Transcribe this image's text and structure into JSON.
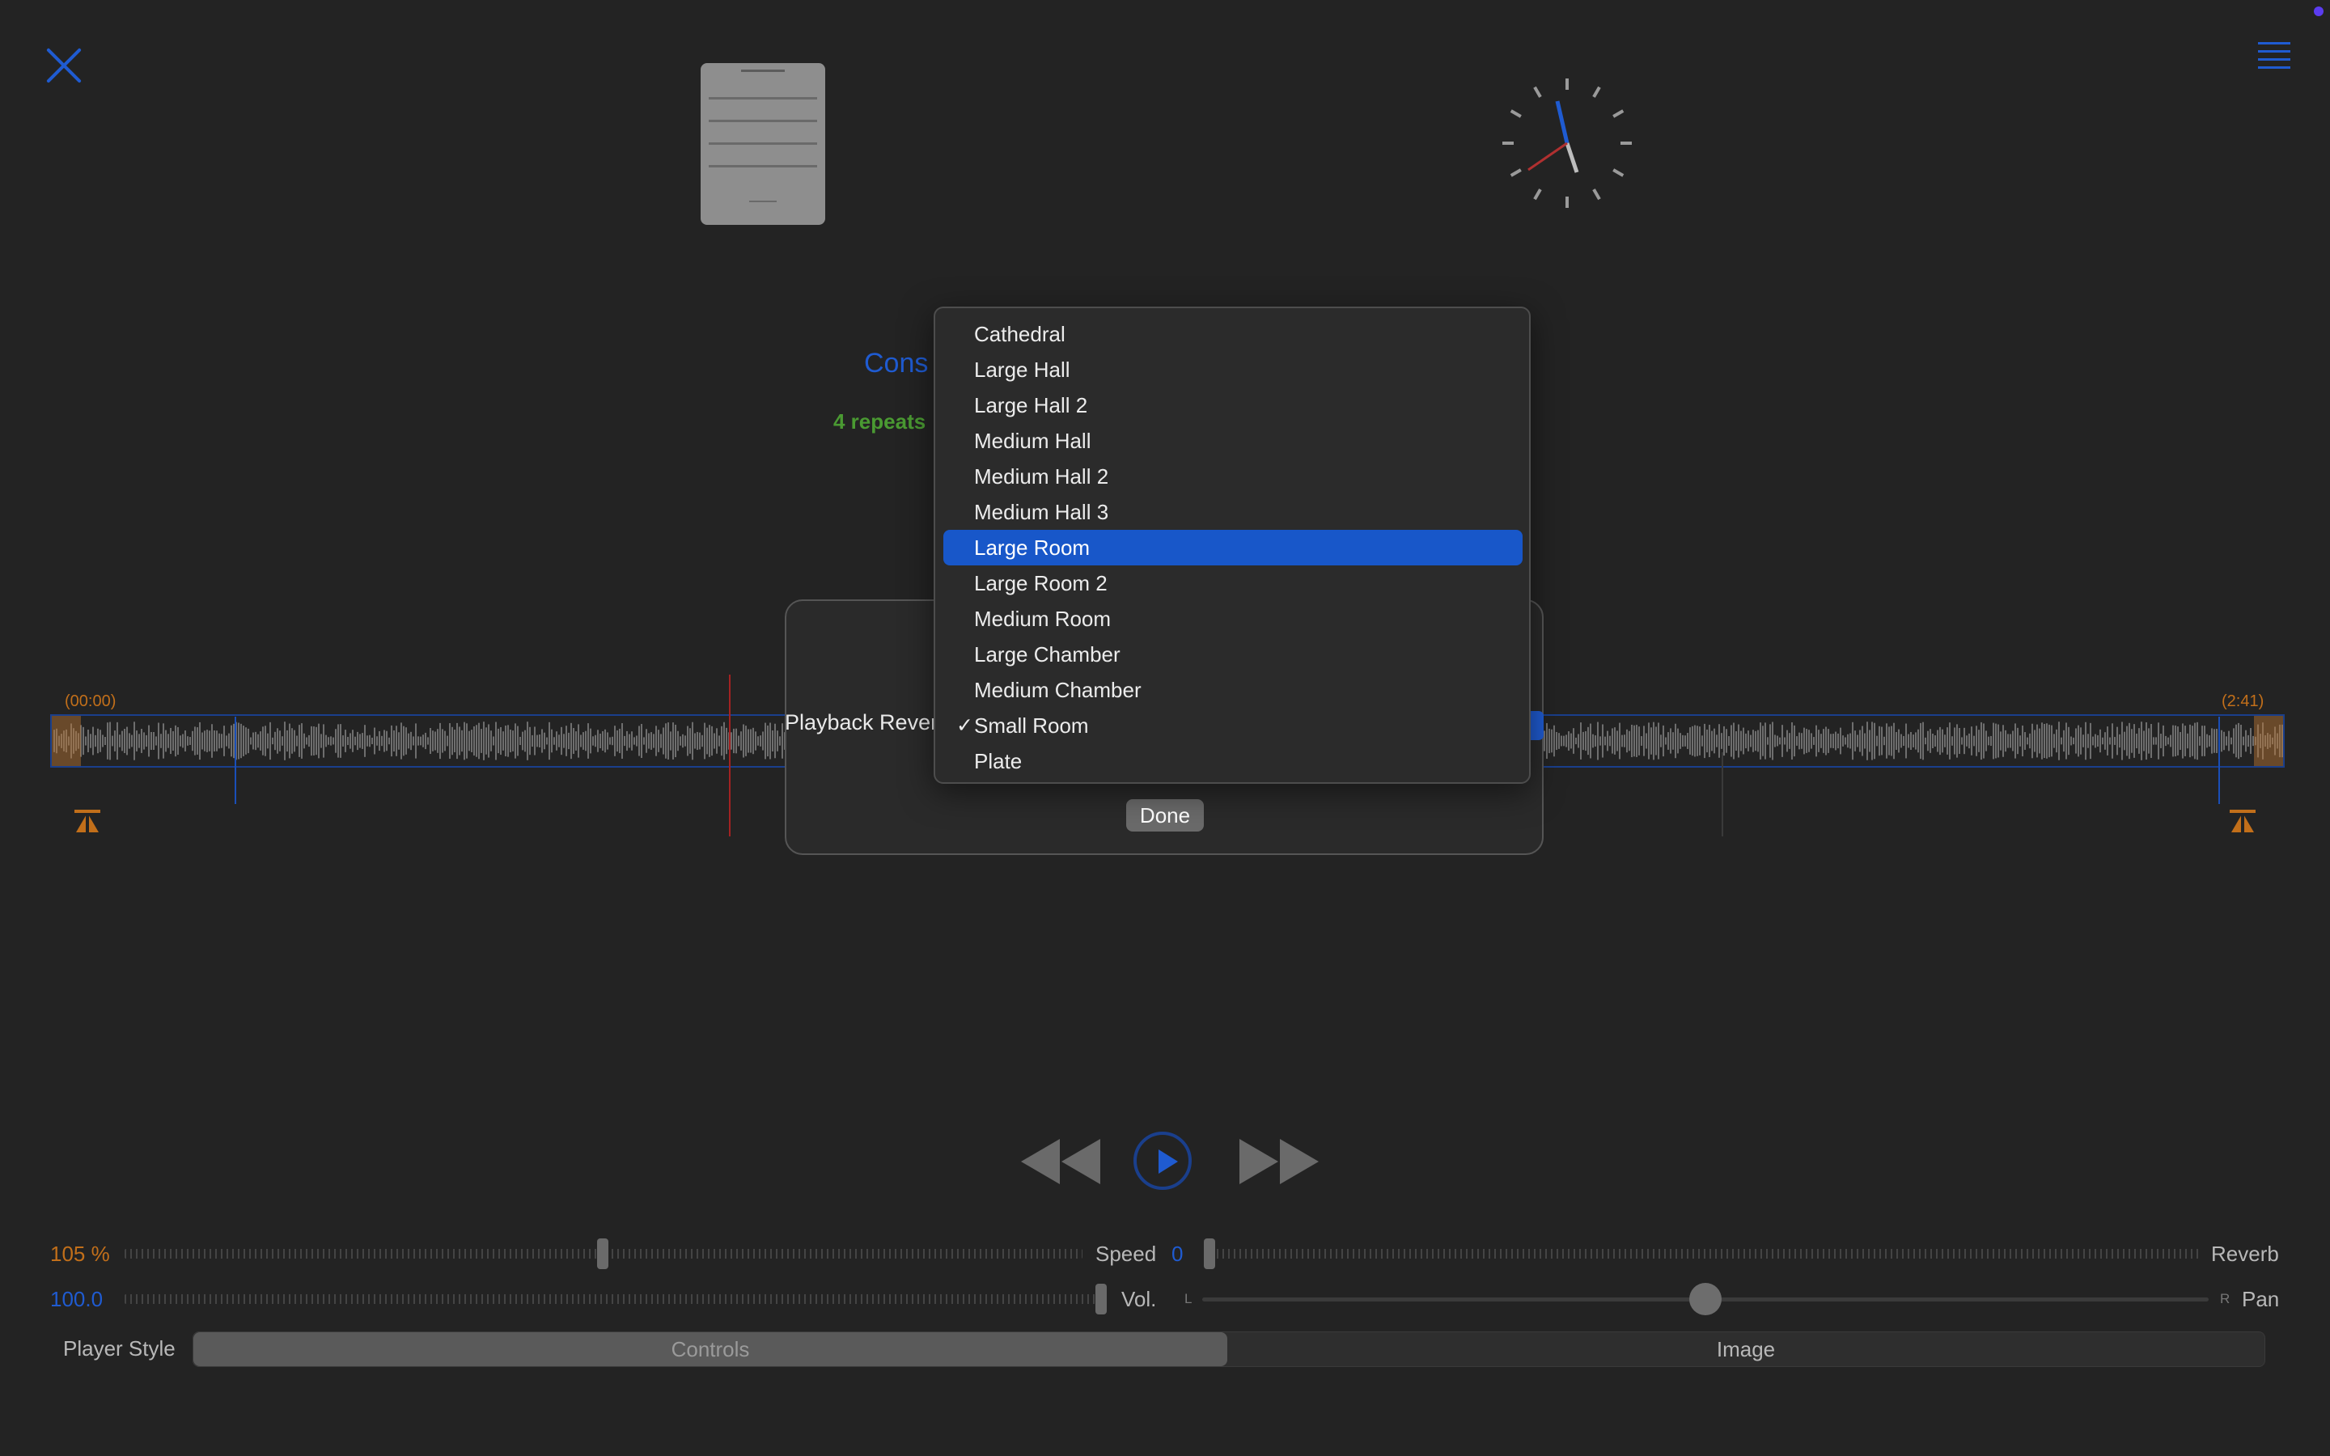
{
  "status": {
    "indicator_color": "#5b3cf0"
  },
  "header": {
    "close_icon": "close-icon",
    "menu_icon": "hamburger-menu-icon"
  },
  "track": {
    "title_fragment": "Cons",
    "repeats_fragment": "4 repeats"
  },
  "waveform": {
    "start_time": "(00:00)",
    "end_time": "(2:41)"
  },
  "controls": {
    "speed_value": "105 %",
    "speed_label": "Speed",
    "reverb_value": "0",
    "reverb_label": "Reverb",
    "volume_value": "100.0",
    "volume_label": "Vol.",
    "pan_left": "L",
    "pan_right": "R",
    "pan_label": "Pan",
    "player_style_label": "Player Style",
    "player_style_options": [
      "Controls",
      "Image"
    ],
    "player_style_selected": "Controls"
  },
  "modal": {
    "label": "Playback Rever",
    "done_label": "Done",
    "options": [
      "Cathedral",
      "Large Hall",
      "Large Hall 2",
      "Medium Hall",
      "Medium Hall 2",
      "Medium Hall 3",
      "Large Room",
      "Large Room 2",
      "Medium Room",
      "Large Chamber",
      "Medium Chamber",
      "Small Room",
      "Plate"
    ],
    "highlighted": "Large Room",
    "checked": "Small Room",
    "check_mark": "✓"
  },
  "colors": {
    "accent": "#1f5bd1",
    "highlight": "#1857c9",
    "orange": "#c26f1a",
    "green": "#4a9a32"
  }
}
